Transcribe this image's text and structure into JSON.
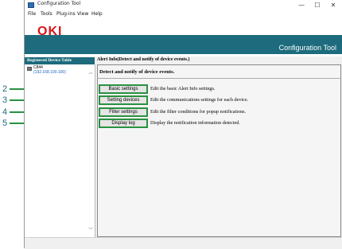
{
  "window": {
    "title": "Configuration Tool",
    "controls": {
      "minimize": "—",
      "maximize": "☐",
      "close": "✕"
    }
  },
  "menu": [
    "File",
    "Tools",
    "Plug-ins",
    "View",
    "Help"
  ],
  "banner": {
    "logo": "OKI",
    "app_name": "Configuration Tool"
  },
  "left_panel": {
    "header": "Registered Device Table",
    "device": {
      "name": "C844",
      "ip": "(192.168.100.100)"
    },
    "scroll_up": "︿",
    "scroll_down": "﹀"
  },
  "right_panel": {
    "header": "Alert Info(Detect and notify of device events.)",
    "title": "Detect and notify of device events.",
    "items": [
      {
        "button": "Basic settings",
        "description": "Edit the basic Alert Info settings.",
        "callout": "2"
      },
      {
        "button": "Setting devices",
        "description": "Edit the communications settings for each device.",
        "callout": "3"
      },
      {
        "button": "Filter settings",
        "description": "Edit the filter conditions for popup notifications.",
        "callout": "4"
      },
      {
        "button": "Display log",
        "description": "Display the notification information detected.",
        "callout": "5"
      }
    ]
  },
  "colors": {
    "brand_red": "#d8151c",
    "banner_teal": "#1d6b7c",
    "callout_green": "#2a9141",
    "link_blue": "#1b5fc1"
  },
  "icons": {
    "app": "app-icon",
    "printer": "printer-icon"
  }
}
